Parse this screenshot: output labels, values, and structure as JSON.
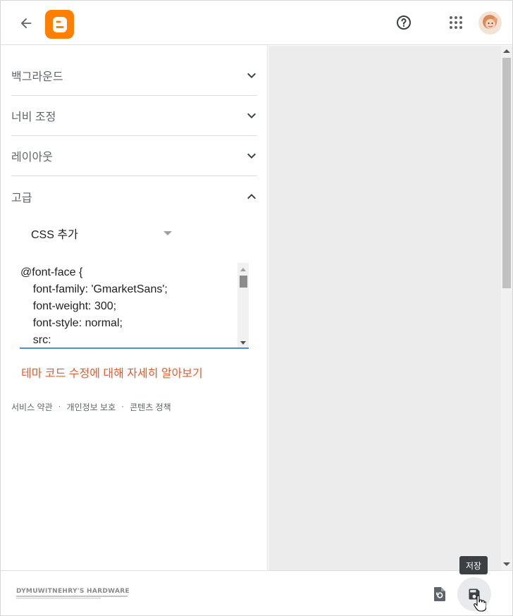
{
  "header": {
    "back_icon": "arrow-left-icon",
    "logo_icon": "blogger-logo-icon",
    "brand_color": "#ff8000",
    "help_icon": "help-circle-icon",
    "apps_icon": "apps-grid-icon",
    "avatar_icon": "user-avatar"
  },
  "sidebar": {
    "sections": [
      {
        "label": "백그라운드",
        "expanded": false
      },
      {
        "label": "너비 조정",
        "expanded": false
      },
      {
        "label": "레이아웃",
        "expanded": false
      },
      {
        "label": "고급",
        "expanded": true
      }
    ],
    "advanced": {
      "select_value": "CSS 추가",
      "css_lines": [
        "@font-face {",
        "    font-family: 'GmarketSans';",
        "    font-weight: 300;",
        "    font-style: normal;",
        "    src:"
      ],
      "learn_more_link": "테마 코드 수정에 대해 자세히 알아보기",
      "link_color": "#e8592b"
    },
    "footer_links": [
      "서비스 약관",
      "개인정보 보호",
      "콘텐츠 정책"
    ],
    "footer_separator": "·"
  },
  "bottom_bar": {
    "revert_icon": "revert-icon",
    "save_icon": "save-icon",
    "save_tooltip": "저장",
    "watermark_text": "DYMUWITNEHRY'S HARDWARE SECTOR"
  }
}
